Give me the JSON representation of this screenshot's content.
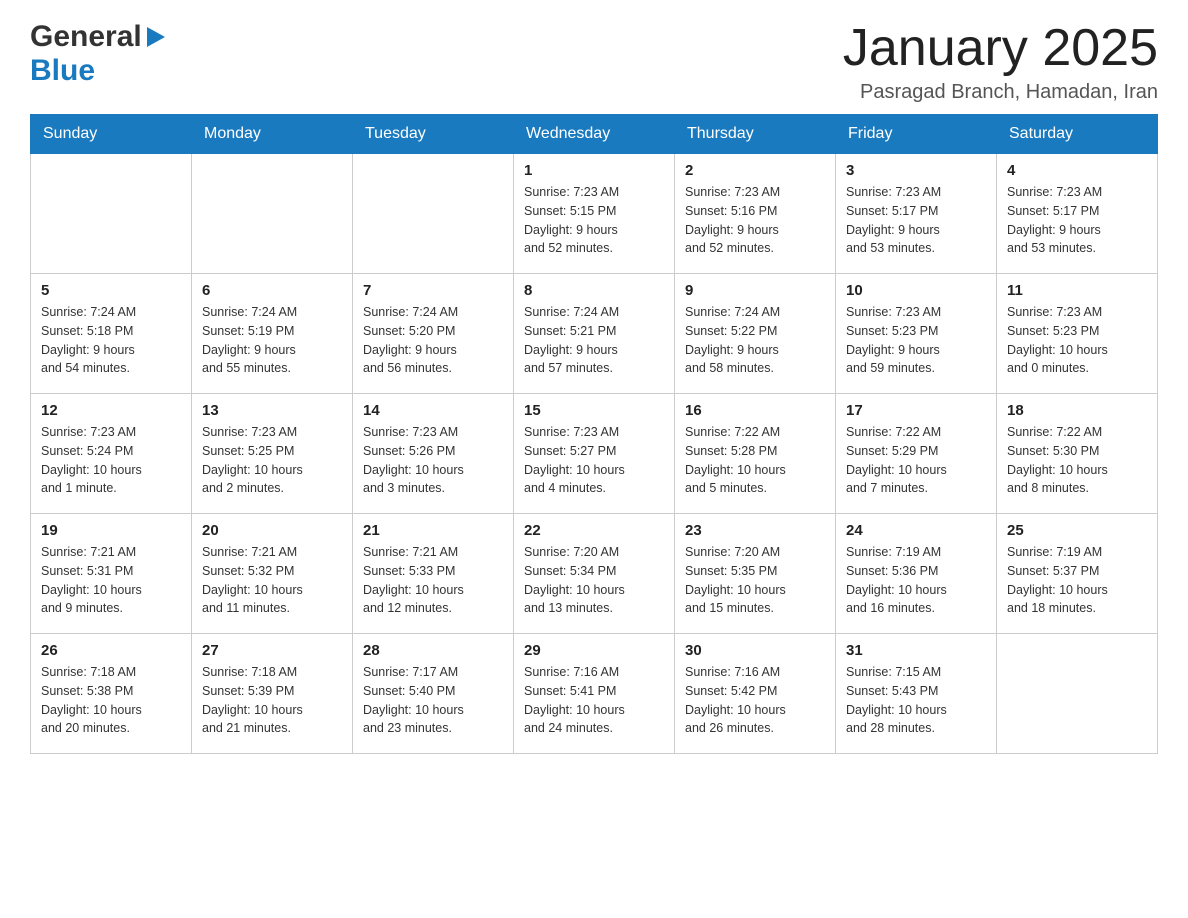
{
  "logo": {
    "general": "General",
    "blue": "Blue"
  },
  "header": {
    "title": "January 2025",
    "subtitle": "Pasragad Branch, Hamadan, Iran"
  },
  "weekdays": [
    "Sunday",
    "Monday",
    "Tuesday",
    "Wednesday",
    "Thursday",
    "Friday",
    "Saturday"
  ],
  "weeks": [
    [
      {
        "day": "",
        "info": ""
      },
      {
        "day": "",
        "info": ""
      },
      {
        "day": "",
        "info": ""
      },
      {
        "day": "1",
        "info": "Sunrise: 7:23 AM\nSunset: 5:15 PM\nDaylight: 9 hours\nand 52 minutes."
      },
      {
        "day": "2",
        "info": "Sunrise: 7:23 AM\nSunset: 5:16 PM\nDaylight: 9 hours\nand 52 minutes."
      },
      {
        "day": "3",
        "info": "Sunrise: 7:23 AM\nSunset: 5:17 PM\nDaylight: 9 hours\nand 53 minutes."
      },
      {
        "day": "4",
        "info": "Sunrise: 7:23 AM\nSunset: 5:17 PM\nDaylight: 9 hours\nand 53 minutes."
      }
    ],
    [
      {
        "day": "5",
        "info": "Sunrise: 7:24 AM\nSunset: 5:18 PM\nDaylight: 9 hours\nand 54 minutes."
      },
      {
        "day": "6",
        "info": "Sunrise: 7:24 AM\nSunset: 5:19 PM\nDaylight: 9 hours\nand 55 minutes."
      },
      {
        "day": "7",
        "info": "Sunrise: 7:24 AM\nSunset: 5:20 PM\nDaylight: 9 hours\nand 56 minutes."
      },
      {
        "day": "8",
        "info": "Sunrise: 7:24 AM\nSunset: 5:21 PM\nDaylight: 9 hours\nand 57 minutes."
      },
      {
        "day": "9",
        "info": "Sunrise: 7:24 AM\nSunset: 5:22 PM\nDaylight: 9 hours\nand 58 minutes."
      },
      {
        "day": "10",
        "info": "Sunrise: 7:23 AM\nSunset: 5:23 PM\nDaylight: 9 hours\nand 59 minutes."
      },
      {
        "day": "11",
        "info": "Sunrise: 7:23 AM\nSunset: 5:23 PM\nDaylight: 10 hours\nand 0 minutes."
      }
    ],
    [
      {
        "day": "12",
        "info": "Sunrise: 7:23 AM\nSunset: 5:24 PM\nDaylight: 10 hours\nand 1 minute."
      },
      {
        "day": "13",
        "info": "Sunrise: 7:23 AM\nSunset: 5:25 PM\nDaylight: 10 hours\nand 2 minutes."
      },
      {
        "day": "14",
        "info": "Sunrise: 7:23 AM\nSunset: 5:26 PM\nDaylight: 10 hours\nand 3 minutes."
      },
      {
        "day": "15",
        "info": "Sunrise: 7:23 AM\nSunset: 5:27 PM\nDaylight: 10 hours\nand 4 minutes."
      },
      {
        "day": "16",
        "info": "Sunrise: 7:22 AM\nSunset: 5:28 PM\nDaylight: 10 hours\nand 5 minutes."
      },
      {
        "day": "17",
        "info": "Sunrise: 7:22 AM\nSunset: 5:29 PM\nDaylight: 10 hours\nand 7 minutes."
      },
      {
        "day": "18",
        "info": "Sunrise: 7:22 AM\nSunset: 5:30 PM\nDaylight: 10 hours\nand 8 minutes."
      }
    ],
    [
      {
        "day": "19",
        "info": "Sunrise: 7:21 AM\nSunset: 5:31 PM\nDaylight: 10 hours\nand 9 minutes."
      },
      {
        "day": "20",
        "info": "Sunrise: 7:21 AM\nSunset: 5:32 PM\nDaylight: 10 hours\nand 11 minutes."
      },
      {
        "day": "21",
        "info": "Sunrise: 7:21 AM\nSunset: 5:33 PM\nDaylight: 10 hours\nand 12 minutes."
      },
      {
        "day": "22",
        "info": "Sunrise: 7:20 AM\nSunset: 5:34 PM\nDaylight: 10 hours\nand 13 minutes."
      },
      {
        "day": "23",
        "info": "Sunrise: 7:20 AM\nSunset: 5:35 PM\nDaylight: 10 hours\nand 15 minutes."
      },
      {
        "day": "24",
        "info": "Sunrise: 7:19 AM\nSunset: 5:36 PM\nDaylight: 10 hours\nand 16 minutes."
      },
      {
        "day": "25",
        "info": "Sunrise: 7:19 AM\nSunset: 5:37 PM\nDaylight: 10 hours\nand 18 minutes."
      }
    ],
    [
      {
        "day": "26",
        "info": "Sunrise: 7:18 AM\nSunset: 5:38 PM\nDaylight: 10 hours\nand 20 minutes."
      },
      {
        "day": "27",
        "info": "Sunrise: 7:18 AM\nSunset: 5:39 PM\nDaylight: 10 hours\nand 21 minutes."
      },
      {
        "day": "28",
        "info": "Sunrise: 7:17 AM\nSunset: 5:40 PM\nDaylight: 10 hours\nand 23 minutes."
      },
      {
        "day": "29",
        "info": "Sunrise: 7:16 AM\nSunset: 5:41 PM\nDaylight: 10 hours\nand 24 minutes."
      },
      {
        "day": "30",
        "info": "Sunrise: 7:16 AM\nSunset: 5:42 PM\nDaylight: 10 hours\nand 26 minutes."
      },
      {
        "day": "31",
        "info": "Sunrise: 7:15 AM\nSunset: 5:43 PM\nDaylight: 10 hours\nand 28 minutes."
      },
      {
        "day": "",
        "info": ""
      }
    ]
  ]
}
